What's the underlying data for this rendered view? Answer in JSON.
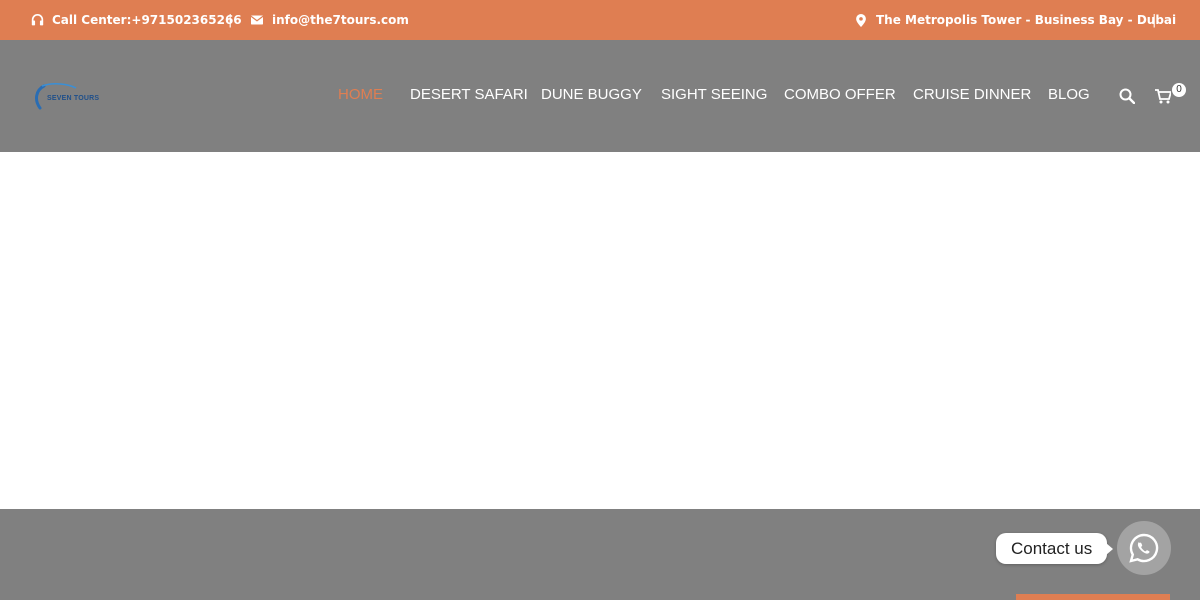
{
  "topbar": {
    "phone": "Call Center:+971502365266",
    "email": "info@the7tours.com",
    "address": "The Metropolis Tower - Business Bay - Dubai",
    "separator": "|",
    "icons": [
      "headset-icon",
      "envelope-icon",
      "map-marker-icon"
    ],
    "background": "#df7e52"
  },
  "header": {
    "logo_text": "SEVEN TOURS",
    "background": "#808080",
    "nav": [
      {
        "label": "HOME",
        "active": true
      },
      {
        "label": "DESERT SAFARI",
        "active": false
      },
      {
        "label": "DUNE BUGGY",
        "active": false
      },
      {
        "label": "SIGHT SEEING",
        "active": false
      },
      {
        "label": "COMBO OFFER",
        "active": false
      },
      {
        "label": "CRUISE DINNER",
        "active": false
      },
      {
        "label": "BLOG",
        "active": false
      }
    ],
    "icons": [
      "search-icon",
      "cart-icon"
    ],
    "cart_count": "0",
    "accent": "#df7e52"
  },
  "chat": {
    "label": "Contact us",
    "icon": "whatsapp-icon"
  }
}
